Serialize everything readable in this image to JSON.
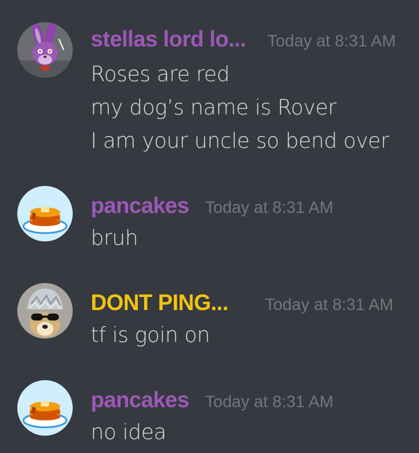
{
  "colors": {
    "background": "#36393f",
    "username_purple": "#9b59b6",
    "username_yellow": "#f1c40f",
    "timestamp": "#72767d",
    "text": "#dcddde"
  },
  "messages": [
    {
      "username": "stellas lord lo...",
      "timestamp": "Today at 8:31 AM",
      "avatar_icon": "purple-bunny-avatar",
      "lines": [
        "Roses are red",
        "my dog’s name is Rover",
        "I am your uncle so bend over"
      ]
    },
    {
      "username": "pancakes",
      "timestamp": "Today at 8:31 AM",
      "avatar_icon": "pancakes-avatar",
      "lines": [
        "bruh"
      ]
    },
    {
      "username": "DONT PING...",
      "timestamp": "Today at 8:31 AM",
      "avatar_icon": "dog-tinfoil-hat-avatar",
      "lines": [
        "tf is goin on"
      ]
    },
    {
      "username": "pancakes",
      "timestamp": "Today at 8:31 AM",
      "avatar_icon": "pancakes-avatar",
      "lines": [
        "no idea"
      ]
    }
  ]
}
